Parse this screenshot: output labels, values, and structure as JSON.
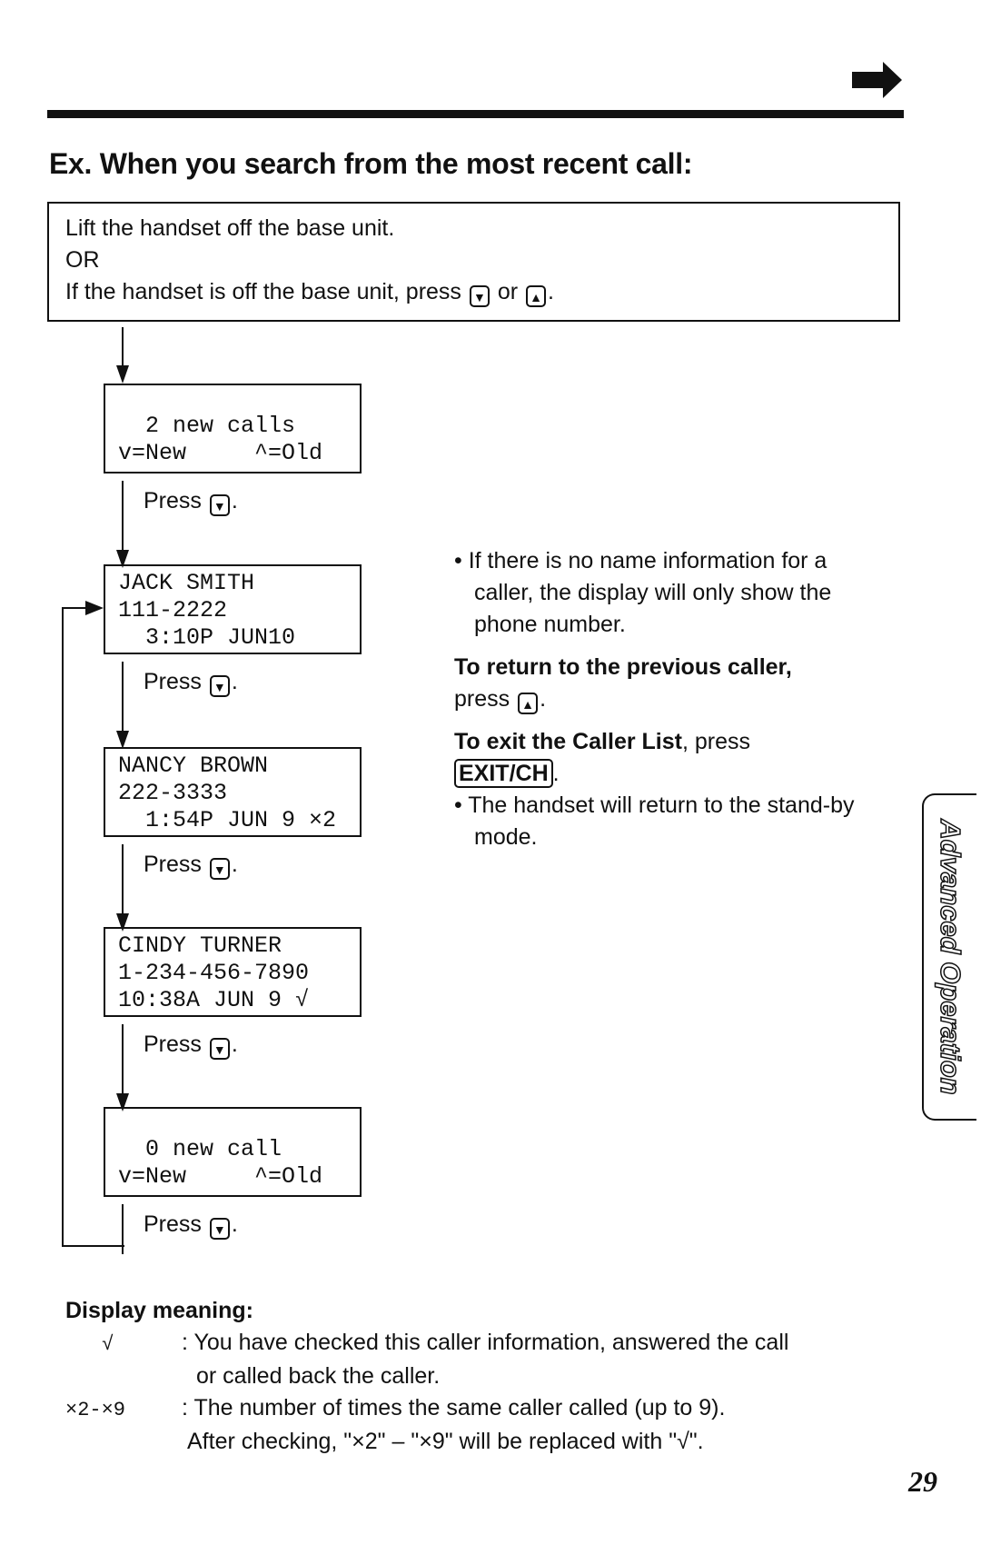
{
  "header": {
    "next_page_icon": "right-arrow-icon"
  },
  "title": "Ex. When you search from the most recent call:",
  "intro": {
    "line1": "Lift the handset off the base unit.",
    "line2": "OR",
    "line3_prefix": "If the handset is off the base unit, press",
    "or": "or",
    "line3_suffix": ".",
    "key_down": "▼",
    "key_up": "▲"
  },
  "flow": [
    {
      "lines": [
        "  2 new calls",
        "v=New     ^=Old"
      ],
      "press": "Press",
      "key": "▼"
    },
    {
      "lines": [
        "JACK SMITH",
        "111-2222",
        "  3:10P JUN10"
      ],
      "press": "Press",
      "key": "▼"
    },
    {
      "lines": [
        "NANCY BROWN",
        "222-3333",
        "  1:54P JUN 9 ×2"
      ],
      "press": "Press",
      "key": "▼"
    },
    {
      "lines": [
        "CINDY TURNER",
        "1-234-456-7890",
        "10:38A JUN 9 √"
      ],
      "press": "Press",
      "key": "▼"
    },
    {
      "lines": [
        "  0 new call",
        "v=New     ^=Old"
      ],
      "press": "Press",
      "key": "▼"
    }
  ],
  "notes": {
    "bullet1": "• If there is no name information for a caller, the display will only show the phone number.",
    "return_bold": "To return to the previous caller,",
    "return_text": "press",
    "return_key": "▲",
    "exit_bold": "To exit the Caller List",
    "exit_text": ", press",
    "exit_key": "EXIT/CH",
    "bullet2": "• The handset will return to the stand-by mode."
  },
  "side_tab": "Advanced Operation",
  "display_meaning": {
    "heading": "Display meaning:",
    "items": [
      {
        "symbol": "√",
        "text1": ": You have checked this caller information, answered the call",
        "text2": "or called back the caller."
      },
      {
        "symbol": "×2-×9",
        "text1": ": The number of times the same caller called (up to 9).",
        "text2": "After checking, \"×2\" – \"×9\" will be replaced with \"√\"."
      }
    ]
  },
  "page_number": "29"
}
